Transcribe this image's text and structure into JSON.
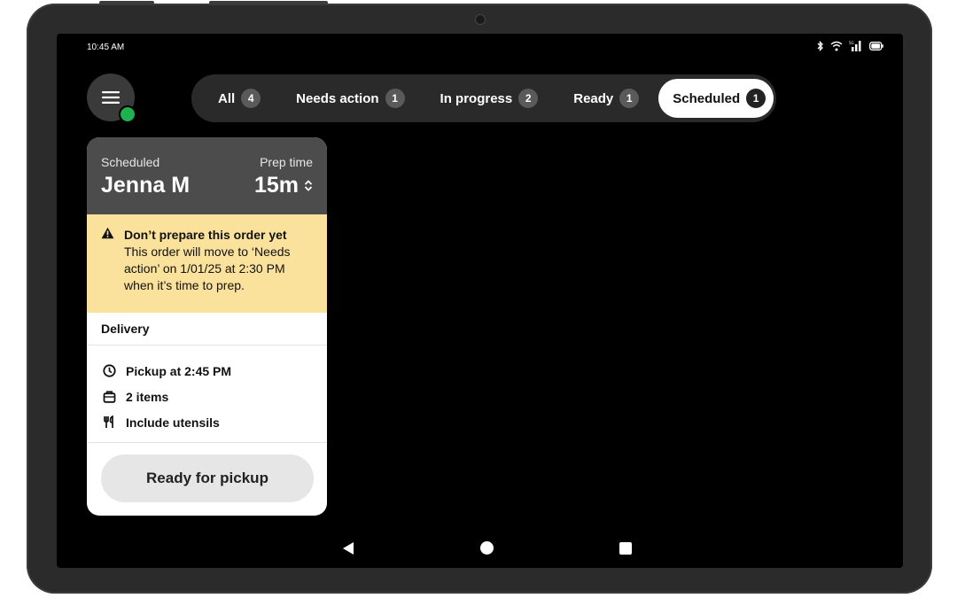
{
  "status_bar": {
    "time": "10:45 AM"
  },
  "tabs": [
    {
      "label": "All",
      "count": "4",
      "active": false
    },
    {
      "label": "Needs action",
      "count": "1",
      "active": false
    },
    {
      "label": "In progress",
      "count": "2",
      "active": false
    },
    {
      "label": "Ready",
      "count": "1",
      "active": false
    },
    {
      "label": "Scheduled",
      "count": "1",
      "active": true
    }
  ],
  "order_card": {
    "status_label": "Scheduled",
    "customer_name": "Jenna M",
    "prep_time_label": "Prep time",
    "prep_time_value": "15m",
    "warning": {
      "title": "Don’t prepare this order yet",
      "body": "This order will move to ‘Needs action’ on 1/01/25 at 2:30 PM when it’s time to prep."
    },
    "fulfillment_type": "Delivery",
    "details": [
      {
        "icon": "clock-icon",
        "text": "Pickup at 2:45 PM"
      },
      {
        "icon": "bag-icon",
        "text": "2 items"
      },
      {
        "icon": "utensils-icon",
        "text": "Include utensils"
      }
    ],
    "action_label": "Ready for pickup"
  },
  "colors": {
    "screen_bg": "#000000",
    "card_header": "#4c4c4c",
    "warning_bg": "#fbe29c",
    "online_dot": "#1fb14f"
  }
}
